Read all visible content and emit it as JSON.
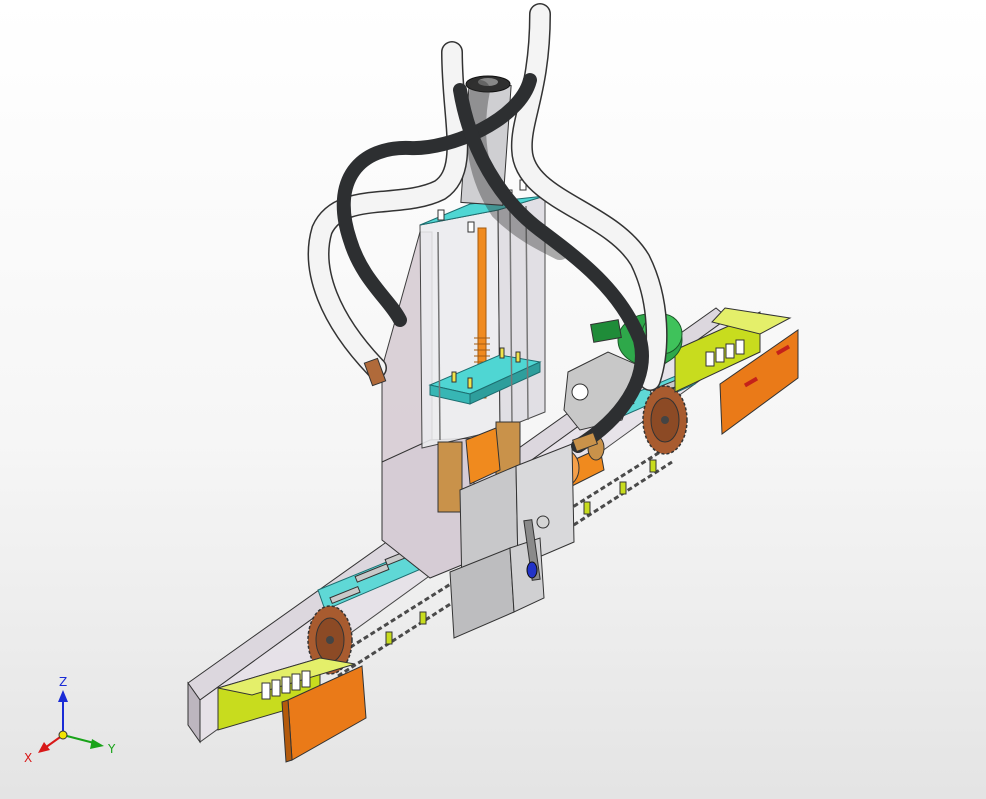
{
  "viewport": {
    "background_top": "#ffffff",
    "background_bottom": "#e4e4e4"
  },
  "triad": {
    "z_label": "Z",
    "x_label": "X",
    "y_label": "Y",
    "colors": {
      "z": "#1a2bd6",
      "x": "#d81818",
      "y": "#19a319",
      "origin": "#f2e400"
    }
  },
  "palette": {
    "frame_plate": "#d9cfd6",
    "column_glass": "#e9e7ea",
    "cyan_plate": "#4fd6d3",
    "orange": "#f08a1e",
    "bronze": "#c9924a",
    "yellow_green": "#c8dc1e",
    "green": "#2ea84a",
    "dark_hose": "#2d2f31",
    "white_hose": "#f4f4f4",
    "steel": "#b9babd"
  }
}
